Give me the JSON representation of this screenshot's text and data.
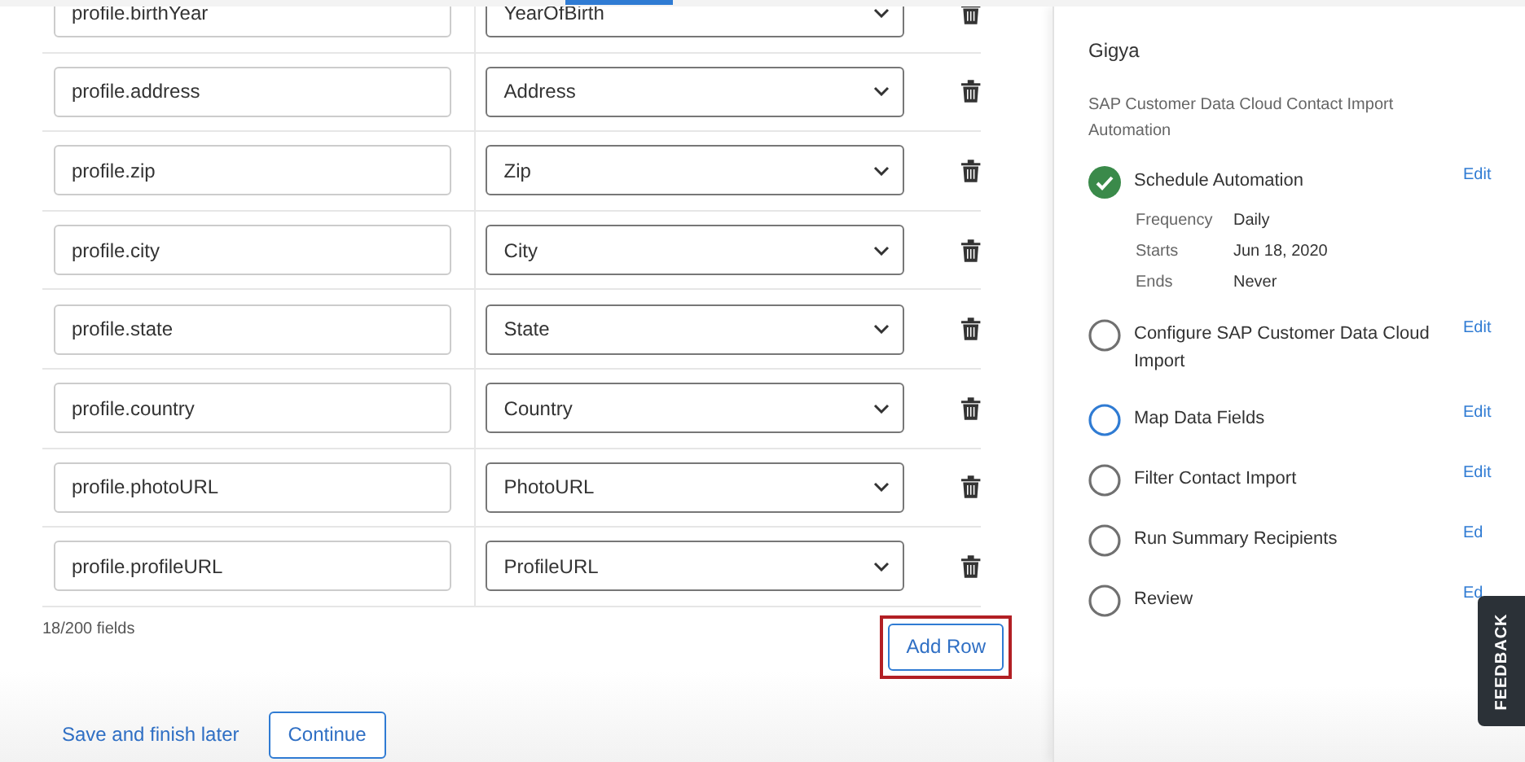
{
  "mappings": [
    {
      "field": "profile.birthYear",
      "value": "YearOfBirth"
    },
    {
      "field": "profile.address",
      "value": "Address"
    },
    {
      "field": "profile.zip",
      "value": "Zip"
    },
    {
      "field": "profile.city",
      "value": "City"
    },
    {
      "field": "profile.state",
      "value": "State"
    },
    {
      "field": "profile.country",
      "value": "Country"
    },
    {
      "field": "profile.photoURL",
      "value": "PhotoURL"
    },
    {
      "field": "profile.profileURL",
      "value": "ProfileURL"
    }
  ],
  "field_count": "18/200 fields",
  "add_row": {
    "label": "Add Row",
    "highlighted": true
  },
  "footer": {
    "save_link": "Save and finish later",
    "continue": "Continue"
  },
  "panel": {
    "title": "Gigya",
    "subtitle": "SAP Customer Data Cloud Contact Import Automation",
    "steps": [
      {
        "label": "Schedule Automation",
        "kind": "done",
        "edit": "Edit",
        "details": [
          {
            "key": "Frequency",
            "value": "Daily"
          },
          {
            "key": "Starts",
            "value": "Jun 18, 2020"
          },
          {
            "key": "Ends",
            "value": "Never"
          }
        ]
      },
      {
        "label": "Configure SAP Customer Data Cloud Import",
        "kind": "pending",
        "edit": "Edit"
      },
      {
        "label": "Map Data Fields",
        "kind": "current",
        "edit": "Edit"
      },
      {
        "label": "Filter Contact Import",
        "kind": "pending",
        "edit": "Edit"
      },
      {
        "label": "Run Summary Recipients",
        "kind": "pending",
        "edit": "Ed"
      },
      {
        "label": "Review",
        "kind": "pending",
        "edit": "Ed"
      }
    ]
  },
  "feedback_tab": "FEEDBACK"
}
